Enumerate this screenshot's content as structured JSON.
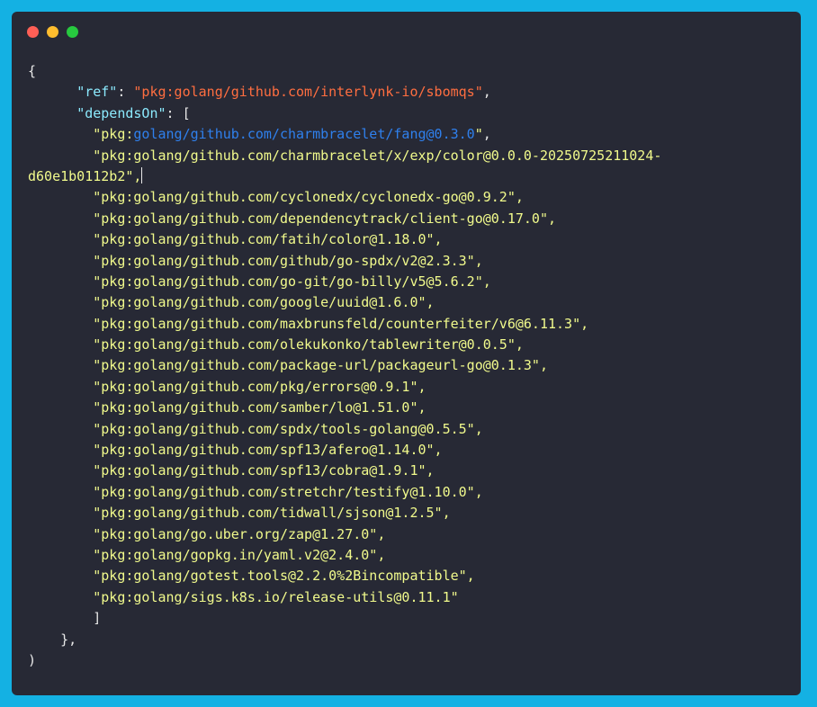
{
  "window": {
    "colors": {
      "background": "#14b1e3",
      "panel": "#272935",
      "key": "#8be9fd",
      "string": "#f1fa8c",
      "ref_value": "#ff6e40",
      "link": "#2f80ed"
    },
    "controls": [
      "close",
      "minimize",
      "maximize"
    ]
  },
  "code": {
    "open_brace": "{",
    "ref_key": "\"ref\"",
    "colon_sep": ": ",
    "ref_value": "\"pkg:golang/github.com/interlynk-io/sbomqs\"",
    "comma": ",",
    "depends_key": "\"dependsOn\"",
    "open_bracket": ": [",
    "first_dep_prefix": "\"pkg:",
    "first_dep_link": "golang/github.com/charmbracelet/fang@0.3.0",
    "first_dep_suffix": "\"",
    "second_dep_line1": "\"pkg:golang/github.com/charmbracelet/x/exp/color@0.0.0-20250725211024-",
    "second_dep_line2": "d60e1b0112b2\",",
    "deps": [
      "\"pkg:golang/github.com/cyclonedx/cyclonedx-go@0.9.2\",",
      "\"pkg:golang/github.com/dependencytrack/client-go@0.17.0\",",
      "\"pkg:golang/github.com/fatih/color@1.18.0\",",
      "\"pkg:golang/github.com/github/go-spdx/v2@2.3.3\",",
      "\"pkg:golang/github.com/go-git/go-billy/v5@5.6.2\",",
      "\"pkg:golang/github.com/google/uuid@1.6.0\",",
      "\"pkg:golang/github.com/maxbrunsfeld/counterfeiter/v6@6.11.3\",",
      "\"pkg:golang/github.com/olekukonko/tablewriter@0.0.5\",",
      "\"pkg:golang/github.com/package-url/packageurl-go@0.1.3\",",
      "\"pkg:golang/github.com/pkg/errors@0.9.1\",",
      "\"pkg:golang/github.com/samber/lo@1.51.0\",",
      "\"pkg:golang/github.com/spdx/tools-golang@0.5.5\",",
      "\"pkg:golang/github.com/spf13/afero@1.14.0\",",
      "\"pkg:golang/github.com/spf13/cobra@1.9.1\",",
      "\"pkg:golang/github.com/stretchr/testify@1.10.0\",",
      "\"pkg:golang/github.com/tidwall/sjson@1.2.5\",",
      "\"pkg:golang/go.uber.org/zap@1.27.0\",",
      "\"pkg:golang/gopkg.in/yaml.v2@2.4.0\",",
      "\"pkg:golang/gotest.tools@2.2.0%2Bincompatible\",",
      "\"pkg:golang/sigs.k8s.io/release-utils@0.11.1\""
    ],
    "close_bracket": "]",
    "close_obj": "},",
    "close_final": ")"
  }
}
